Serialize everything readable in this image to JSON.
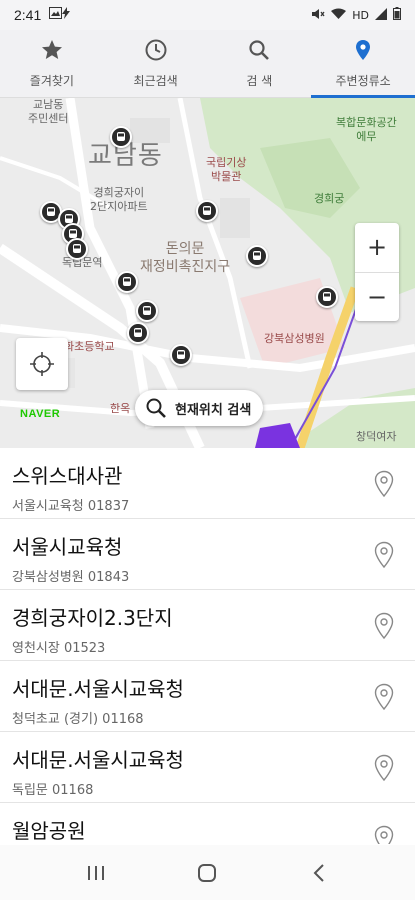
{
  "status": {
    "time": "2:41",
    "right_text": "HD"
  },
  "tabs": [
    {
      "label": "즐겨찾기",
      "icon": "star-icon"
    },
    {
      "label": "최근검색",
      "icon": "clock-icon"
    },
    {
      "label": "검 색",
      "icon": "search-icon"
    },
    {
      "label": "주변정류소",
      "icon": "location-pin-icon"
    }
  ],
  "map": {
    "labels": {
      "center1": "교남동\n주민센터",
      "dong": "교남동",
      "apt": "경희궁자이\n2단지아파트",
      "donuimun": "돈의문\n재정비촉진지구",
      "station": "독립문역",
      "school": "화초등학교",
      "museum": "국립기상\n박물관",
      "palace": "경희궁",
      "culture": "복합문화공간\n에무",
      "hospital": "강북삼성병원",
      "girls": "창덕여자",
      "han": "한옥"
    },
    "brand": "NAVER",
    "search_here": "현재위치 검색",
    "zoom_in": "+",
    "zoom_out": "−"
  },
  "stops": [
    {
      "name": "스위스대사관",
      "sub": "서울시교육청  01837"
    },
    {
      "name": "서울시교육청",
      "sub": "강북삼성병원  01843"
    },
    {
      "name": "경희궁자이2.3단지",
      "sub": "영천시장  01523"
    },
    {
      "name": "서대문.서울시교육청",
      "sub": "청덕초교 (경기) 01168"
    },
    {
      "name": "서대문.서울시교육청",
      "sub": "독립문  01168"
    },
    {
      "name": "월암공원",
      "sub": ""
    }
  ],
  "colors": {
    "accent": "#1e6fd0",
    "naver": "#1ec800",
    "bus_marker": "#2b2b2b"
  }
}
